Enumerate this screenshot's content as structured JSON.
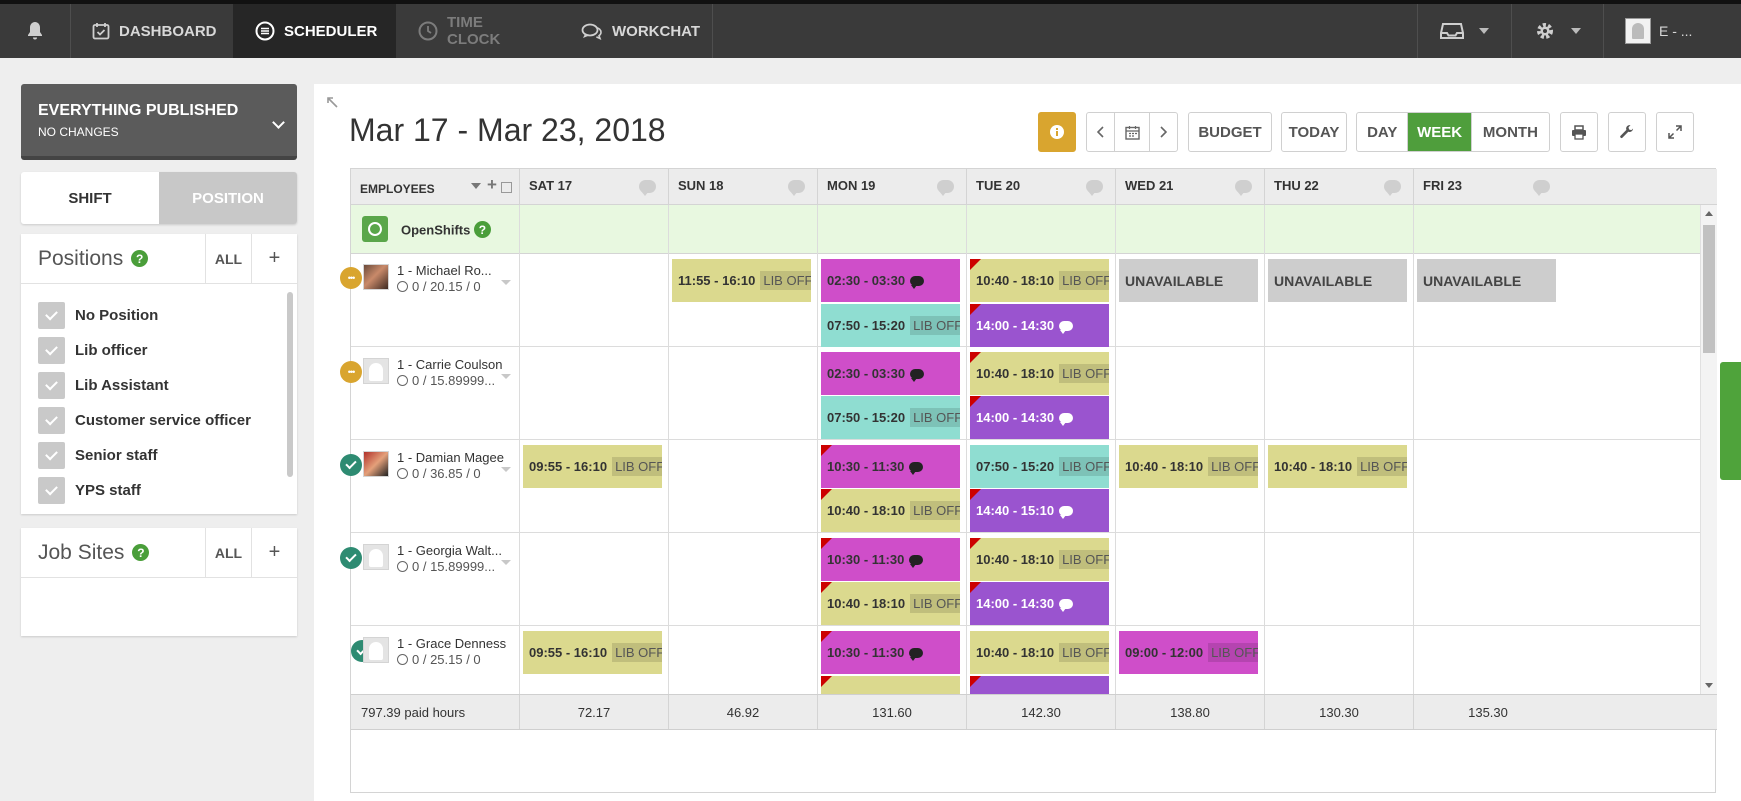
{
  "topnav": {
    "items": [
      {
        "label": "DASHBOARD",
        "icon": "calendar-check-icon"
      },
      {
        "label": "SCHEDULER",
        "icon": "list-circle-icon"
      },
      {
        "label": "TIME CLOCK",
        "icon": "clock-icon"
      },
      {
        "label": "WORKCHAT",
        "icon": "chat-icon"
      }
    ],
    "user_label": "E - ..."
  },
  "sidebar": {
    "publish_title": "EVERYTHING PUBLISHED",
    "publish_subtitle": "NO CHANGES",
    "toggle": {
      "shift": "SHIFT",
      "position": "POSITION"
    },
    "positions": {
      "title": "Positions",
      "all_label": "ALL",
      "add_label": "+",
      "items": [
        "No Position",
        "Lib officer",
        "Lib Assistant",
        "Customer service officer",
        "Senior staff",
        "YPS staff"
      ]
    },
    "jobsites": {
      "title": "Job Sites",
      "all_label": "ALL",
      "add_label": "+"
    }
  },
  "toolbar": {
    "date_range": "Mar 17 - Mar 23, 2018",
    "budget": "BUDGET",
    "today": "TODAY",
    "view": {
      "day": "DAY",
      "week": "WEEK",
      "month": "MONTH",
      "selected": "WEEK"
    }
  },
  "grid": {
    "employees_header": "EMPLOYEES",
    "days": [
      "SAT 17",
      "SUN 18",
      "MON 19",
      "TUE 20",
      "WED 21",
      "THU 22",
      "FRI 23"
    ],
    "openshifts_label": "OpenShifts",
    "employees": [
      {
        "name": "1 - Michael Ro...",
        "hours": "0 / 20.15 / 0"
      },
      {
        "name": "1 - Carrie Coulson",
        "hours": "0 / 15.89999..."
      },
      {
        "name": "1 - Damian Magee",
        "hours": "0 / 36.85 / 0"
      },
      {
        "name": "1 - Georgia Walt...",
        "hours": "0 / 15.89999..."
      },
      {
        "name": "1 - Grace Denness",
        "hours": "0 / 25.15 / 0"
      }
    ],
    "shift_texts": {
      "s01": "11:55 - 16:10",
      "s02": "02:30 - 03:30",
      "s03": "07:50 - 15:20",
      "s04": "10:40 - 18:10",
      "s05": "14:00 - 14:30",
      "s06": "02:30 - 03:30",
      "s07": "07:50 - 15:20",
      "s08": "10:40 - 18:10",
      "s09": "14:00 - 14:30",
      "s10": "09:55 - 16:10",
      "s11": "10:30 - 11:30",
      "s12": "10:40 - 18:10",
      "s13": "07:50 - 15:20",
      "s14": "14:40 - 15:10",
      "s15": "10:40 - 18:10",
      "s16": "10:40 - 18:10",
      "s17": "10:30 - 11:30",
      "s18": "10:40 - 18:10",
      "s19": "10:40 - 18:10",
      "s20": "14:00 - 14:30",
      "s21": "09:55 - 16:10",
      "s22": "10:30 - 11:30",
      "s23": "10:40 - 18:10",
      "s24": "09:00 - 12:00"
    },
    "position_tag": "LIB OFFIC",
    "position_tag_alt": "LIB OFFICI",
    "unavailable": "UNAVAILABLE",
    "footer": {
      "total": "797.39 paid hours",
      "daily": [
        "72.17",
        "46.92",
        "131.60",
        "142.30",
        "138.80",
        "130.30",
        "135.30"
      ]
    }
  },
  "colors": {
    "topbar": "#3a3a3a",
    "accent_green": "#4f9e3c",
    "info_gold": "#d9a52f",
    "shift_yellow": "#dbd98e",
    "shift_teal": "#8fddd1",
    "shift_magenta": "#cf4ec9",
    "shift_purple": "#9a54cf",
    "unavailable_gray": "#cdcdcd",
    "openshifts_bg": "#e8f8e0"
  }
}
